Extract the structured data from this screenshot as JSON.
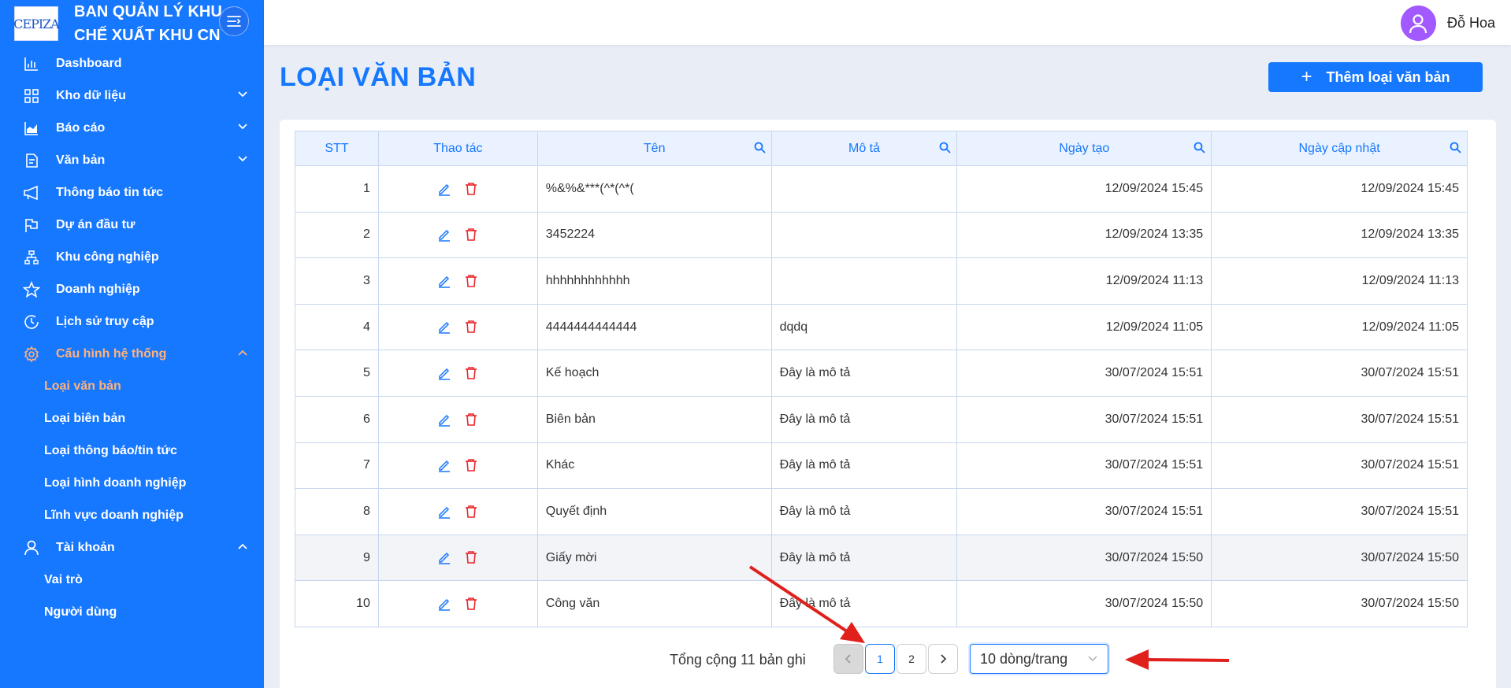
{
  "brand": {
    "logo_text": "CEPIZA",
    "title_line1": "BAN QUẢN LÝ KHU",
    "title_line2": "CHẾ XUẤT KHU CN"
  },
  "user": {
    "name": "Đỗ Hoa"
  },
  "sidebar": {
    "items": [
      {
        "label": "Dashboard",
        "icon": "bar-chart-icon"
      },
      {
        "label": "Kho dữ liệu",
        "icon": "grid-icon"
      },
      {
        "label": "Báo cáo",
        "icon": "area-chart-icon"
      },
      {
        "label": "Văn bản",
        "icon": "document-icon"
      },
      {
        "label": "Thông báo tin tức",
        "icon": "megaphone-icon"
      },
      {
        "label": "Dự án đầu tư",
        "icon": "flag-icon"
      },
      {
        "label": "Khu công nghiệp",
        "icon": "cluster-icon"
      },
      {
        "label": "Doanh nghiệp",
        "icon": "star-icon"
      },
      {
        "label": "Lịch sử truy cập",
        "icon": "clock-icon"
      },
      {
        "label": "Cấu hình hệ thống",
        "icon": "gear-icon"
      },
      {
        "label": "Tài khoản",
        "icon": "user-icon"
      }
    ],
    "config_sub": [
      "Loại văn bản",
      "Loại biên bản",
      "Loại thông báo/tin tức",
      "Loại hình doanh nghiệp",
      "Lĩnh vực doanh nghiệp"
    ],
    "account_sub": [
      "Vai trò",
      "Người dùng"
    ]
  },
  "page": {
    "title": "LOẠI VĂN BẢN",
    "add_button": "Thêm loại văn bản"
  },
  "table": {
    "headers": {
      "stt": "STT",
      "actions": "Thao tác",
      "name": "Tên",
      "desc": "Mô tả",
      "created": "Ngày tạo",
      "updated": "Ngày cập nhật"
    },
    "rows": [
      {
        "stt": "1",
        "name": "%&%&***(^*(^*(",
        "desc": "",
        "created": "12/09/2024 15:45",
        "updated": "12/09/2024 15:45"
      },
      {
        "stt": "2",
        "name": "3452224",
        "desc": "",
        "created": "12/09/2024 13:35",
        "updated": "12/09/2024 13:35"
      },
      {
        "stt": "3",
        "name": "hhhhhhhhhhhh",
        "desc": "",
        "created": "12/09/2024 11:13",
        "updated": "12/09/2024 11:13"
      },
      {
        "stt": "4",
        "name": "4444444444444",
        "desc": "dqdq",
        "created": "12/09/2024 11:05",
        "updated": "12/09/2024 11:05"
      },
      {
        "stt": "5",
        "name": "Kế hoạch",
        "desc": "Đây là mô tả",
        "created": "30/07/2024 15:51",
        "updated": "30/07/2024 15:51"
      },
      {
        "stt": "6",
        "name": "Biên bản",
        "desc": "Đây là mô tả",
        "created": "30/07/2024 15:51",
        "updated": "30/07/2024 15:51"
      },
      {
        "stt": "7",
        "name": "Khác",
        "desc": "Đây là mô tả",
        "created": "30/07/2024 15:51",
        "updated": "30/07/2024 15:51"
      },
      {
        "stt": "8",
        "name": "Quyết định",
        "desc": "Đây là mô tả",
        "created": "30/07/2024 15:51",
        "updated": "30/07/2024 15:51"
      },
      {
        "stt": "9",
        "name": "Giấy mời",
        "desc": "Đây là mô tả",
        "created": "30/07/2024 15:50",
        "updated": "30/07/2024 15:50"
      },
      {
        "stt": "10",
        "name": "Công văn",
        "desc": "Đây là mô tả",
        "created": "30/07/2024 15:50",
        "updated": "30/07/2024 15:50"
      }
    ]
  },
  "pagination": {
    "total_text": "Tổng cộng 11 bản ghi",
    "prev": "<",
    "pages": [
      "1",
      "2"
    ],
    "next": ">",
    "current_page": "1",
    "page_size": "10 dòng/trang"
  },
  "colors": {
    "primary": "#1677ff",
    "active_menu": "#ffb27a",
    "delete": "#e8262b",
    "annotation_arrow": "#e0201b"
  }
}
